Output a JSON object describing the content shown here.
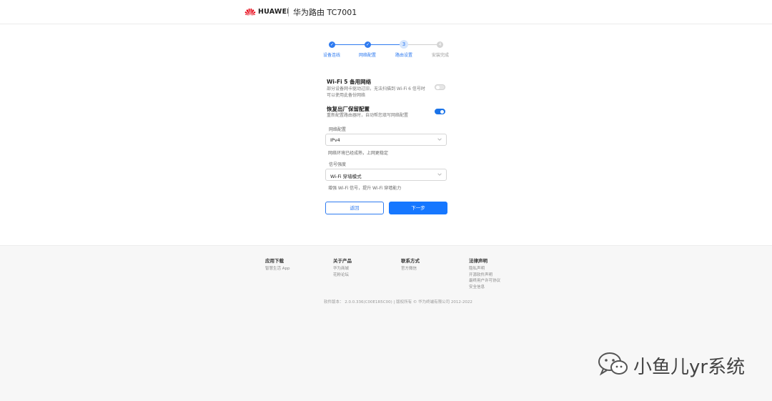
{
  "header": {
    "brand": "HUAWEI",
    "product": "华为路由 TC7001"
  },
  "steps": [
    {
      "label": "设备连线",
      "state": "done",
      "num": "✓"
    },
    {
      "label": "网络配置",
      "state": "done",
      "num": "✓"
    },
    {
      "label": "路由设置",
      "state": "current",
      "num": "3"
    },
    {
      "label": "安装完成",
      "state": "todo",
      "num": "4"
    }
  ],
  "wifi5_backup": {
    "title": "Wi-Fi 5 备用网络",
    "desc_line1": "部分设备网卡驱动过旧，无法扫描到 Wi-Fi 6 信号时",
    "desc_line2": "可以使用此备份网络",
    "enabled": false
  },
  "restore_factory": {
    "title": "恢复出厂保留配置",
    "desc": "重新配置路由器时，自动帮您填写网络配置",
    "enabled": true
  },
  "network_config": {
    "label": "网络配置",
    "value": "IPv4",
    "hint": "网络环境已经成熟，上网更稳定"
  },
  "signal_strength": {
    "label": "信号强度",
    "value": "Wi-Fi 穿墙模式",
    "hint": "增强 Wi-Fi 信号，提升 Wi-Fi 穿墙能力"
  },
  "buttons": {
    "back": "返回",
    "next": "下一步"
  },
  "footer": {
    "columns": [
      {
        "title": "应用下载",
        "items": [
          "智慧生活 App"
        ]
      },
      {
        "title": "关于产品",
        "items": [
          "华为商城",
          "花粉论坛"
        ]
      },
      {
        "title": "联系方式",
        "items": [
          "官方微信"
        ]
      },
      {
        "title": "法律声明",
        "items": [
          "隐私声明",
          "开源软件声明",
          "最终用户许可协议",
          "安全信息"
        ]
      }
    ],
    "copyright": "软件版本： 2.0.0.336(C00E1R5C00)  |  版权所有 © 华为终端有限公司 2012-2022"
  },
  "watermark": "小鱼儿yr系统",
  "colors": {
    "accent": "#1677ff",
    "brand_red": "#e60012"
  }
}
